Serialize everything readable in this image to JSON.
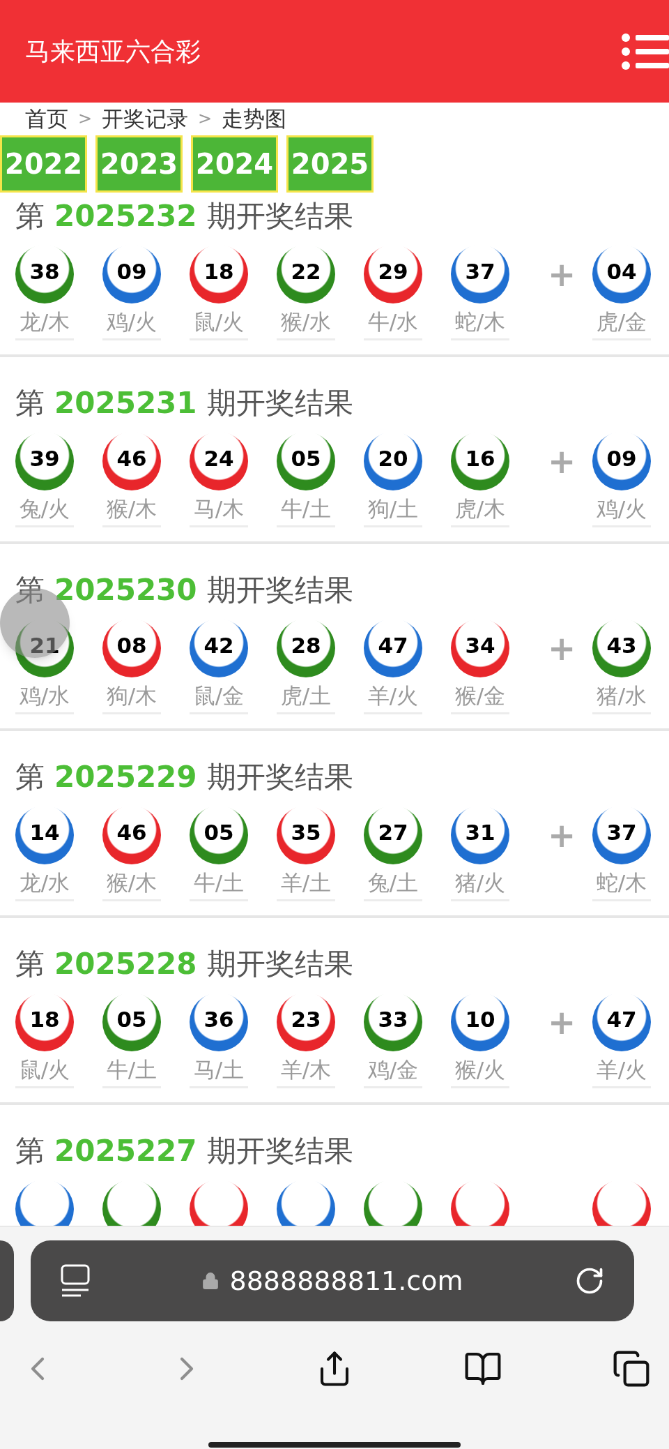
{
  "header": {
    "title": "马来西亚六合彩"
  },
  "breadcrumb": [
    {
      "label": "首页"
    },
    {
      "separator": ">",
      "label": "开奖记录"
    },
    {
      "separator": ">",
      "label": "走势图"
    }
  ],
  "years": [
    "2022",
    "2023",
    "2024",
    "2025"
  ],
  "draws": [
    {
      "prefix": "第",
      "issue": "2025232",
      "suffix": "期开奖结果",
      "plus": "+",
      "balls": [
        {
          "number": "38",
          "color": "#2e8b1e",
          "label": "龙/木"
        },
        {
          "number": "09",
          "color": "#1f6fd1",
          "label": "鸡/火"
        },
        {
          "number": "18",
          "color": "#e8262b",
          "label": "鼠/火"
        },
        {
          "number": "22",
          "color": "#2e8b1e",
          "label": "猴/水"
        },
        {
          "number": "29",
          "color": "#e8262b",
          "label": "牛/水"
        },
        {
          "number": "37",
          "color": "#1f6fd1",
          "label": "蛇/木"
        },
        {
          "number": "04",
          "color": "#1f6fd1",
          "label": "虎/金"
        }
      ]
    },
    {
      "prefix": "第",
      "issue": "2025231",
      "suffix": "期开奖结果",
      "plus": "+",
      "balls": [
        {
          "number": "39",
          "color": "#2e8b1e",
          "label": "兔/火"
        },
        {
          "number": "46",
          "color": "#e8262b",
          "label": "猴/木"
        },
        {
          "number": "24",
          "color": "#e8262b",
          "label": "马/木"
        },
        {
          "number": "05",
          "color": "#2e8b1e",
          "label": "牛/土"
        },
        {
          "number": "20",
          "color": "#1f6fd1",
          "label": "狗/土"
        },
        {
          "number": "16",
          "color": "#2e8b1e",
          "label": "虎/木"
        },
        {
          "number": "09",
          "color": "#1f6fd1",
          "label": "鸡/火"
        }
      ]
    },
    {
      "prefix": "第",
      "issue": "2025230",
      "suffix": "期开奖结果",
      "plus": "+",
      "balls": [
        {
          "number": "21",
          "color": "#2e8b1e",
          "label": "鸡/水"
        },
        {
          "number": "08",
          "color": "#e8262b",
          "label": "狗/木"
        },
        {
          "number": "42",
          "color": "#1f6fd1",
          "label": "鼠/金"
        },
        {
          "number": "28",
          "color": "#2e8b1e",
          "label": "虎/土"
        },
        {
          "number": "47",
          "color": "#1f6fd1",
          "label": "羊/火"
        },
        {
          "number": "34",
          "color": "#e8262b",
          "label": "猴/金"
        },
        {
          "number": "43",
          "color": "#2e8b1e",
          "label": "猪/水"
        }
      ]
    },
    {
      "prefix": "第",
      "issue": "2025229",
      "suffix": "期开奖结果",
      "plus": "+",
      "balls": [
        {
          "number": "14",
          "color": "#1f6fd1",
          "label": "龙/水"
        },
        {
          "number": "46",
          "color": "#e8262b",
          "label": "猴/木"
        },
        {
          "number": "05",
          "color": "#2e8b1e",
          "label": "牛/土"
        },
        {
          "number": "35",
          "color": "#e8262b",
          "label": "羊/土"
        },
        {
          "number": "27",
          "color": "#2e8b1e",
          "label": "兔/土"
        },
        {
          "number": "31",
          "color": "#1f6fd1",
          "label": "猪/火"
        },
        {
          "number": "37",
          "color": "#1f6fd1",
          "label": "蛇/木"
        }
      ]
    },
    {
      "prefix": "第",
      "issue": "2025228",
      "suffix": "期开奖结果",
      "plus": "+",
      "balls": [
        {
          "number": "18",
          "color": "#e8262b",
          "label": "鼠/火"
        },
        {
          "number": "05",
          "color": "#2e8b1e",
          "label": "牛/土"
        },
        {
          "number": "36",
          "color": "#1f6fd1",
          "label": "马/土"
        },
        {
          "number": "23",
          "color": "#e8262b",
          "label": "羊/木"
        },
        {
          "number": "33",
          "color": "#2e8b1e",
          "label": "鸡/金"
        },
        {
          "number": "10",
          "color": "#1f6fd1",
          "label": "猴/火"
        },
        {
          "number": "47",
          "color": "#1f6fd1",
          "label": "羊/火"
        }
      ]
    },
    {
      "prefix": "第",
      "issue": "2025227",
      "suffix": "期开奖结果",
      "balls": [
        {
          "color": "#1f6fd1"
        },
        {
          "color": "#2e8b1e"
        },
        {
          "color": "#e8262b"
        },
        {
          "color": "#1f6fd1"
        },
        {
          "color": "#2e8b1e"
        },
        {
          "color": "#e8262b"
        },
        {
          "color": "#e8262b"
        }
      ]
    }
  ],
  "browser": {
    "url": "8888888811.com"
  }
}
